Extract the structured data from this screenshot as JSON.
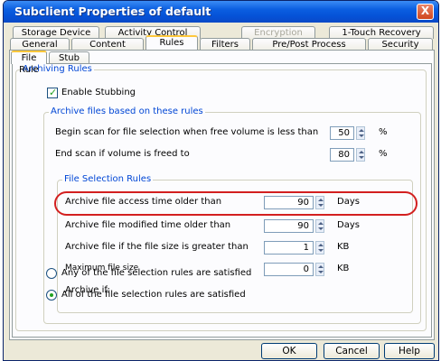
{
  "window": {
    "title": "Subclient Properties of default",
    "close_label": "X"
  },
  "tabs_row1": [
    {
      "label": "Storage Device"
    },
    {
      "label": "Activity Control"
    },
    {
      "label": "Encryption"
    },
    {
      "label": "1-Touch Recovery"
    }
  ],
  "tabs_row2": [
    {
      "label": "General"
    },
    {
      "label": "Content"
    },
    {
      "label": "Rules"
    },
    {
      "label": "Filters"
    },
    {
      "label": "Pre/Post Process"
    },
    {
      "label": "Security"
    }
  ],
  "subtabs": [
    {
      "label": "File Rule"
    },
    {
      "label": "Stub Rule"
    }
  ],
  "archiving": {
    "group_label": "Archiving Rules",
    "enable_stubbing_label": "Enable Stubbing",
    "archive_files_group": "Archive files based on these rules",
    "begin_scan_label": "Begin scan for file selection when free volume is less than",
    "begin_scan_value": "50",
    "begin_scan_unit": "%",
    "end_scan_label": "End scan if volume is freed to",
    "end_scan_value": "80",
    "end_scan_unit": "%",
    "file_selection_group": "File Selection Rules",
    "access_time_label": "Archive file access time older than",
    "access_time_value": "90",
    "access_time_unit": "Days",
    "modified_time_label": "Archive file modified time older than",
    "modified_time_value": "90",
    "modified_time_unit": "Days",
    "size_label": "Archive file if the file size is greater than",
    "size_value": "1",
    "size_unit": "KB",
    "max_size_label": "Maximum file size",
    "max_size_value": "0",
    "max_size_unit": "KB",
    "archive_if_label": "Archive if:",
    "any_rule_label": "Any of the file selection rules are satisfied",
    "all_rules_label": "All of the file selection rules are satisfied"
  },
  "footer": {
    "ok_label": "OK",
    "cancel_label": "Cancel",
    "help_label": "Help"
  },
  "colors": {
    "highlight": "#d31f1f",
    "group_label": "#0046d5"
  }
}
